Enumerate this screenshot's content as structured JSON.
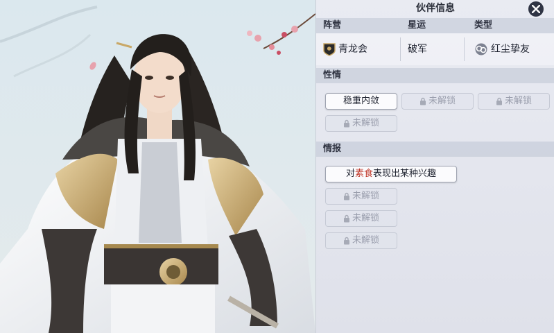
{
  "panel": {
    "title": "伙伴信息",
    "columns": {
      "faction": "阵营",
      "star": "星运",
      "type": "类型"
    },
    "values": {
      "faction": "青龙会",
      "star": "破军",
      "type": "红尘挚友"
    },
    "personality": {
      "header": "性情",
      "traits": [
        "稳重内敛",
        "未解锁",
        "未解锁",
        "未解锁"
      ]
    },
    "intel": {
      "header": "情报",
      "first": {
        "prefix": "对",
        "highlight": "素食",
        "suffix": "表现出某种兴趣"
      },
      "locked": [
        "未解锁",
        "未解锁",
        "未解锁"
      ]
    }
  },
  "colors": {
    "highlight": "#c0392b",
    "panel_bg": "#e9ebf2"
  }
}
